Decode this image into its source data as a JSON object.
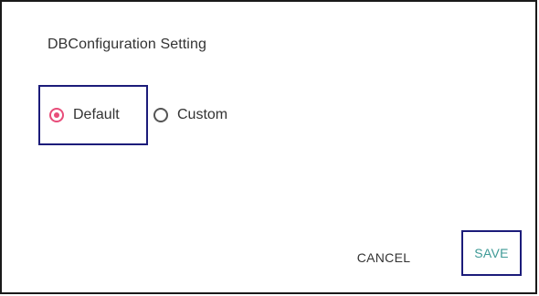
{
  "dialog": {
    "title": "DBConfiguration Setting",
    "options": [
      {
        "label": "Default",
        "selected": true
      },
      {
        "label": "Custom",
        "selected": false
      }
    ],
    "actions": {
      "cancel_label": "CANCEL",
      "save_label": "SAVE"
    }
  },
  "colors": {
    "radio_selected": "#e84d7a",
    "save_text": "#3e9a96",
    "highlight_border": "#1c1c7a"
  }
}
